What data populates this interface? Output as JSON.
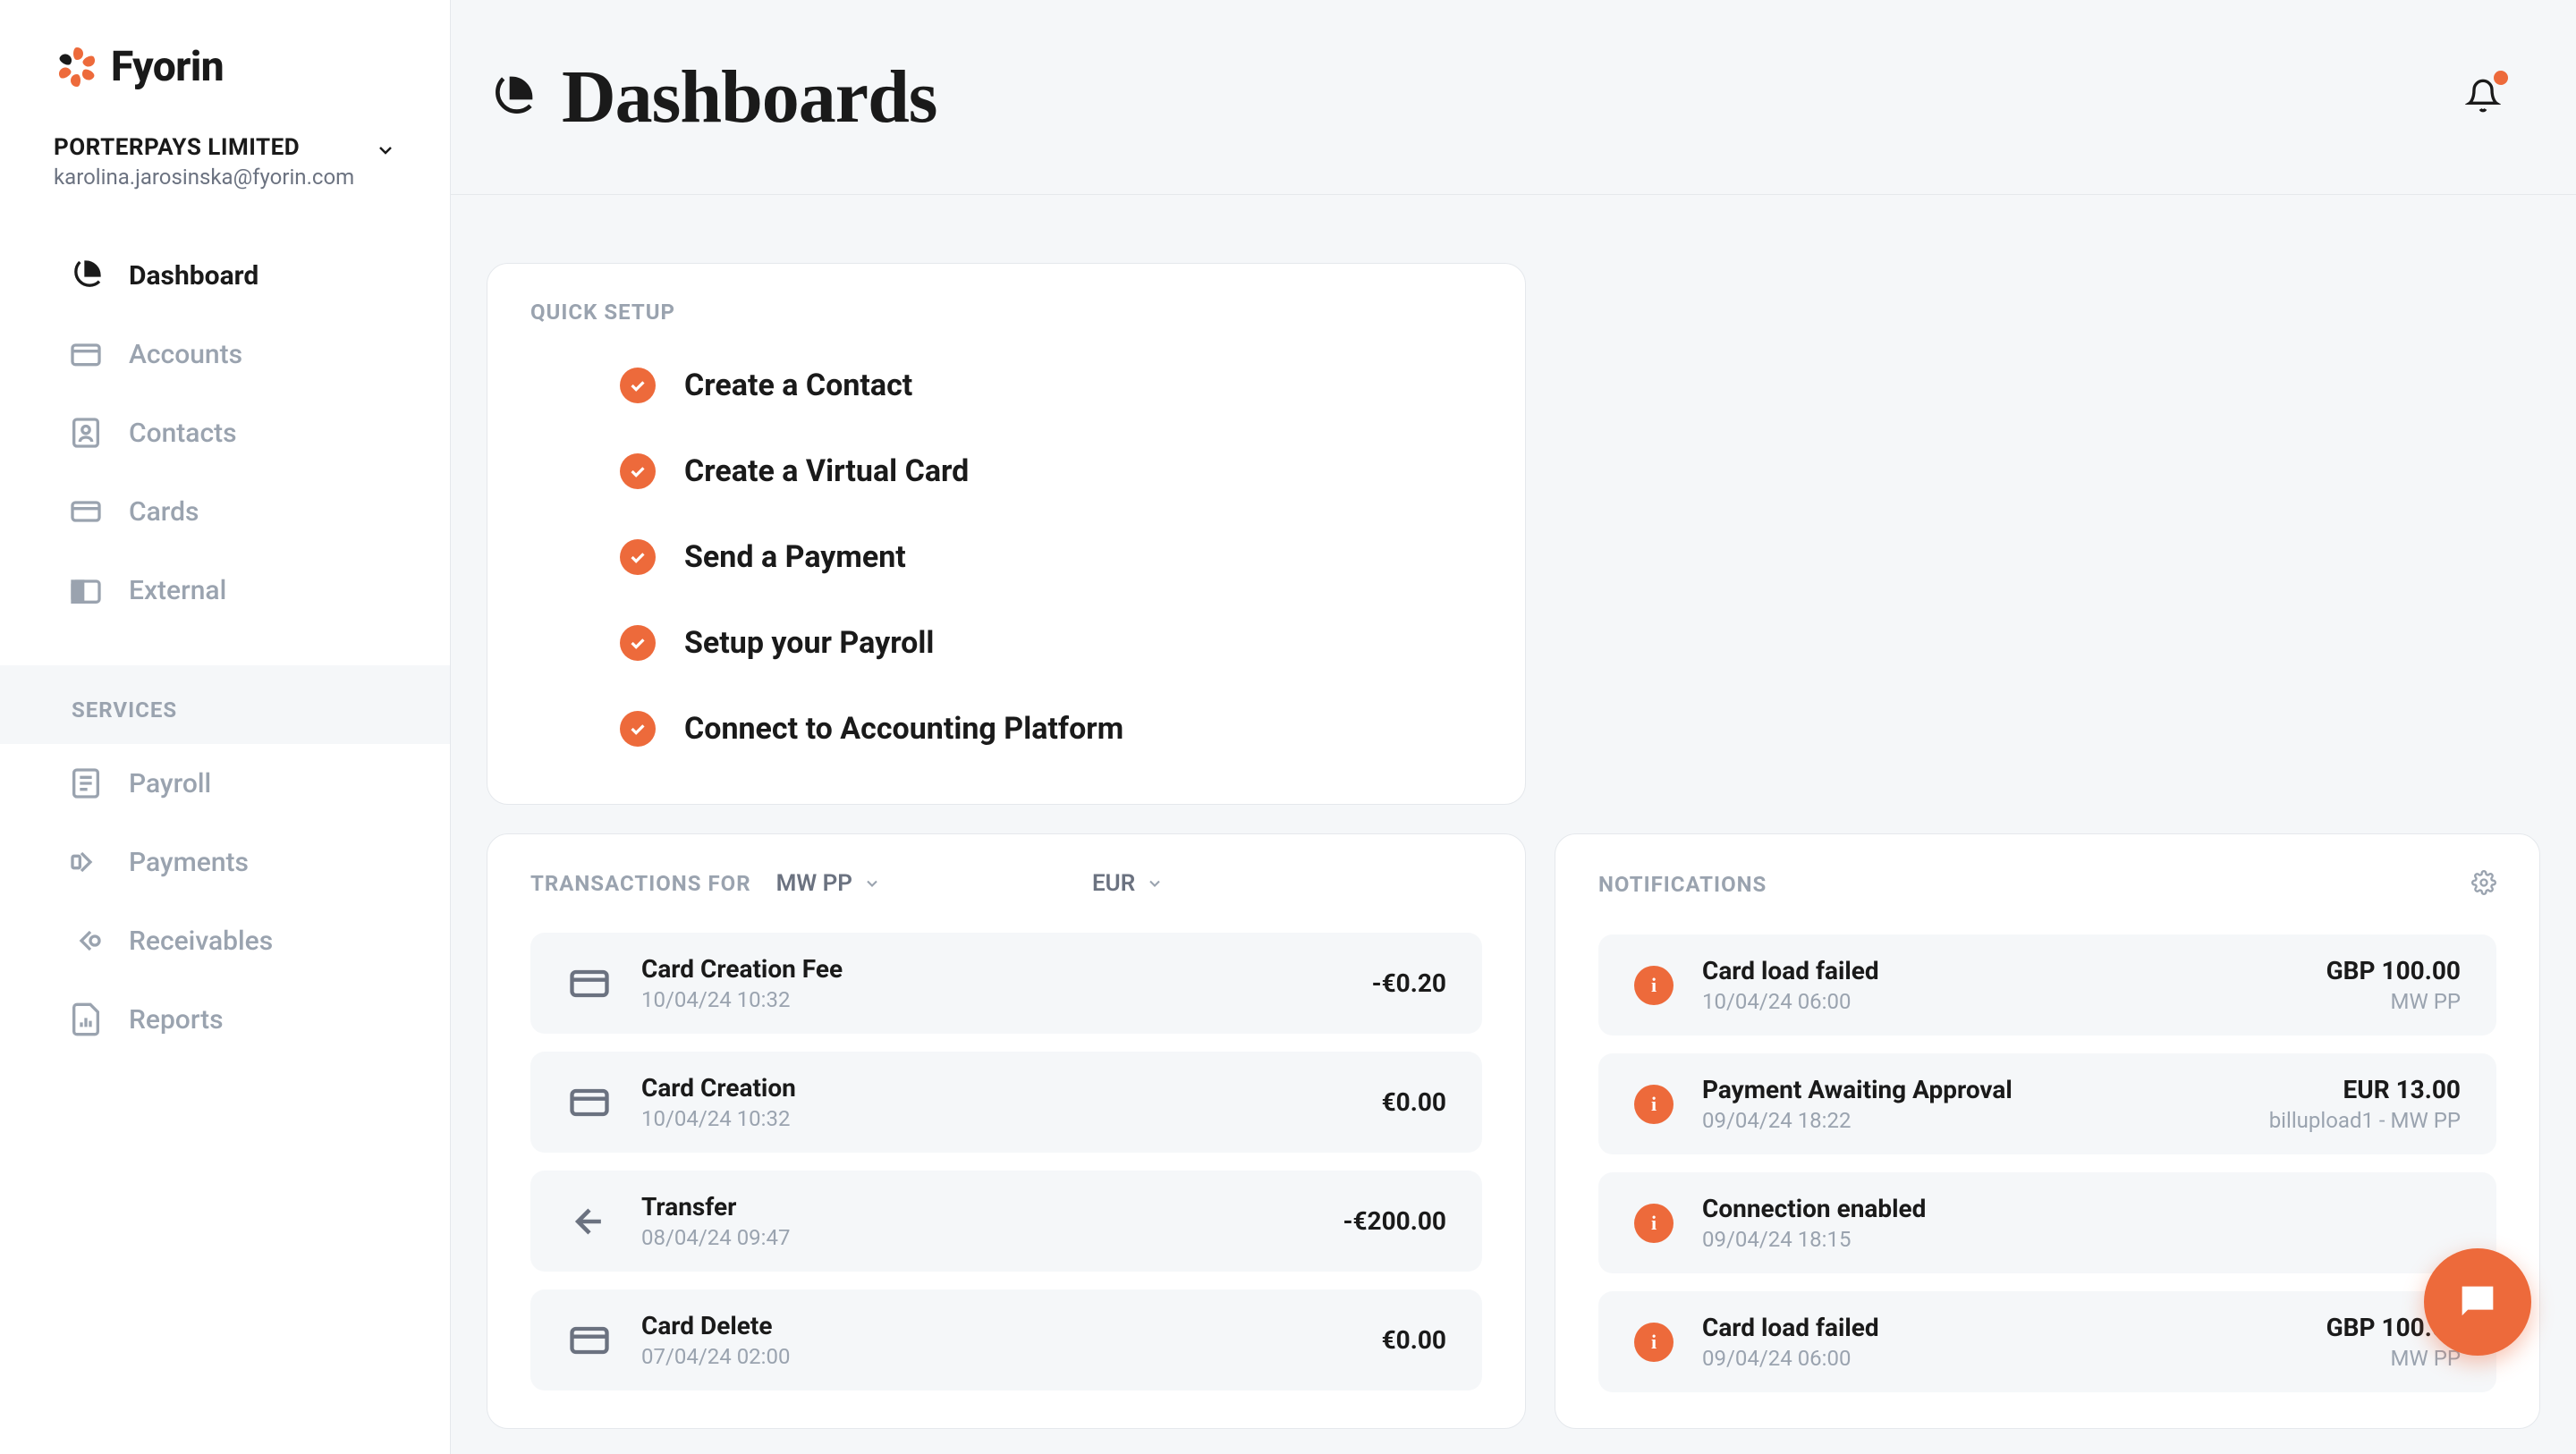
{
  "brand": {
    "name": "Fyorin"
  },
  "company": {
    "name": "PORTERPAYS LIMITED",
    "email": "karolina.jarosinska@fyorin.com"
  },
  "sidebar": {
    "items": [
      {
        "label": "Dashboard",
        "active": true
      },
      {
        "label": "Accounts"
      },
      {
        "label": "Contacts"
      },
      {
        "label": "Cards"
      },
      {
        "label": "External"
      }
    ],
    "services_title": "SERVICES",
    "services": [
      {
        "label": "Payroll"
      },
      {
        "label": "Payments"
      },
      {
        "label": "Receivables"
      },
      {
        "label": "Reports"
      }
    ]
  },
  "header": {
    "title": "Dashboards"
  },
  "quick_setup": {
    "title": "QUICK SETUP",
    "items": [
      {
        "label": "Create a Contact"
      },
      {
        "label": "Create a Virtual Card"
      },
      {
        "label": "Send a Payment"
      },
      {
        "label": "Setup your Payroll"
      },
      {
        "label": "Connect to Accounting Platform"
      }
    ]
  },
  "transactions": {
    "title": "TRANSACTIONS FOR",
    "account": "MW PP",
    "currency": "EUR",
    "items": [
      {
        "title": "Card Creation Fee",
        "ts": "10/04/24 10:32",
        "amount": "-€0.20",
        "icon": "card"
      },
      {
        "title": "Card Creation",
        "ts": "10/04/24 10:32",
        "amount": "€0.00",
        "icon": "card"
      },
      {
        "title": "Transfer",
        "ts": "08/04/24 09:47",
        "amount": "-€200.00",
        "icon": "arrow"
      },
      {
        "title": "Card Delete",
        "ts": "07/04/24 02:00",
        "amount": "€0.00",
        "icon": "card"
      }
    ]
  },
  "notifications": {
    "title": "NOTIFICATIONS",
    "items": [
      {
        "title": "Card load failed",
        "ts": "10/04/24 06:00",
        "amount": "GBP 100.00",
        "meta": "MW PP"
      },
      {
        "title": "Payment Awaiting Approval",
        "ts": "09/04/24 18:22",
        "amount": "EUR 13.00",
        "meta": "billupload1 - MW PP"
      },
      {
        "title": "Connection enabled",
        "ts": "09/04/24 18:15",
        "amount": "",
        "meta": ""
      },
      {
        "title": "Card load failed",
        "ts": "09/04/24 06:00",
        "amount": "GBP 100.00",
        "meta": "MW PP"
      }
    ]
  }
}
